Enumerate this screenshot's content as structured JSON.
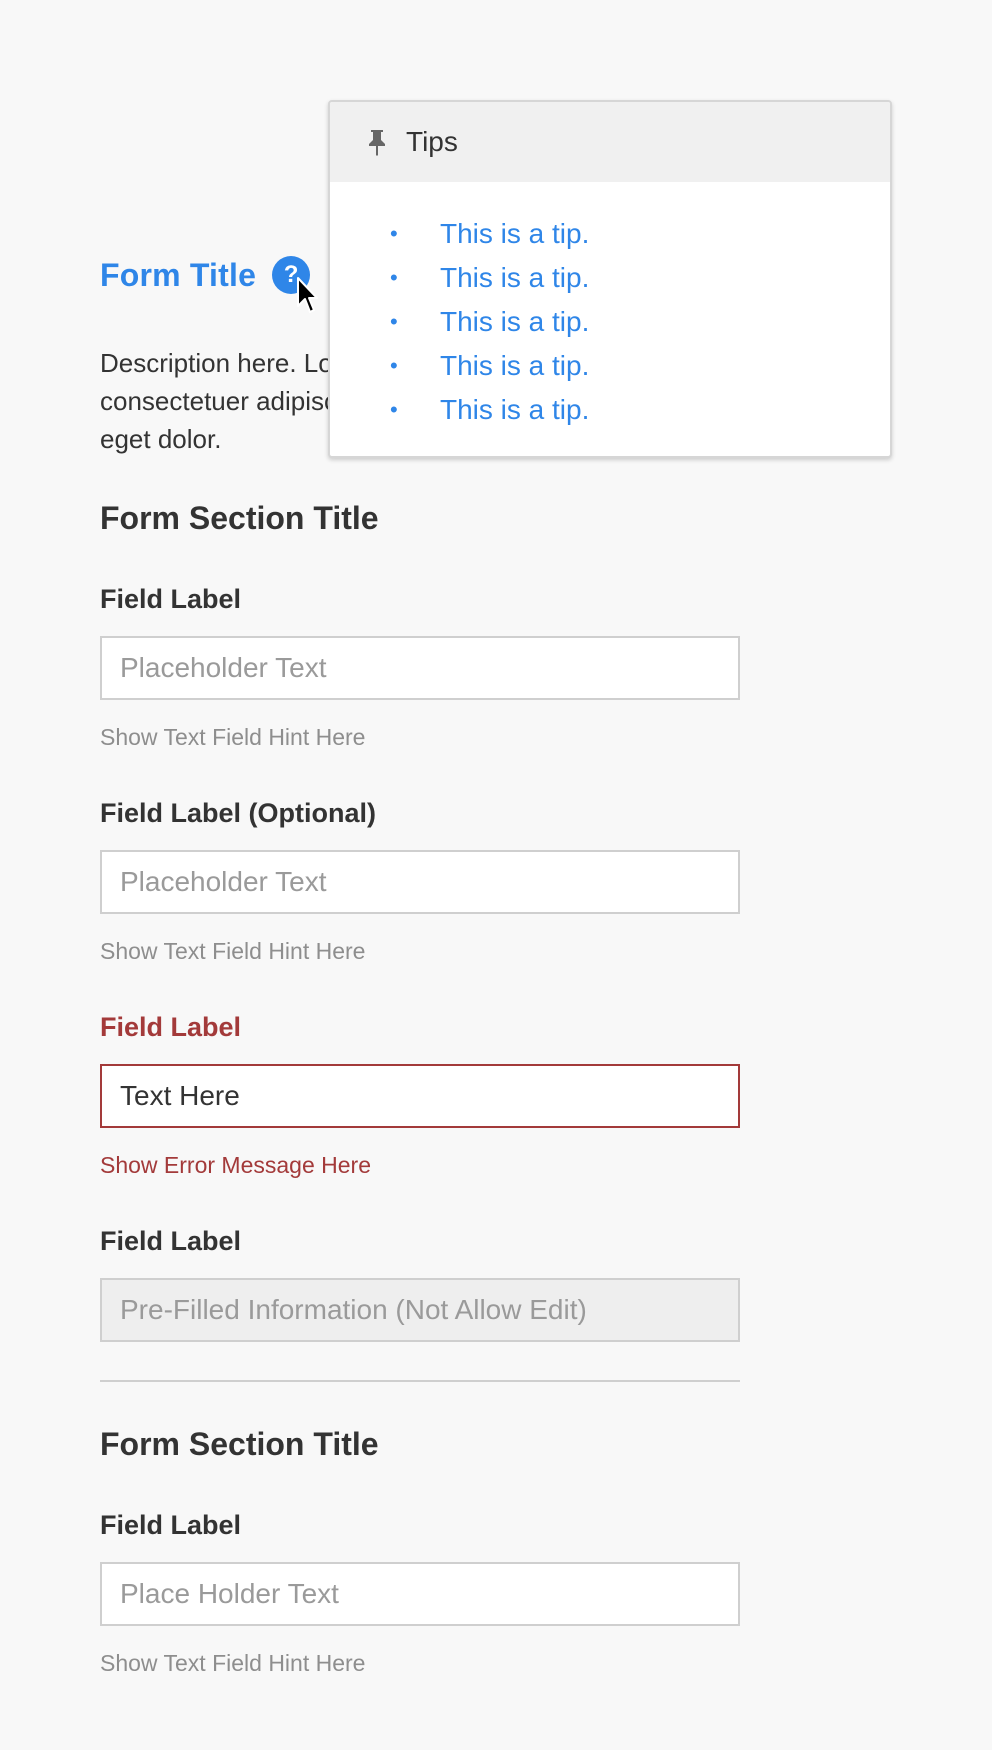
{
  "form": {
    "title": "Form Title",
    "help_symbol": "?",
    "description": "Description here. Lorem ipsum dolor sit amet, consectetuer adipiscing elit. Aenean commodo ligula eget dolor."
  },
  "tips": {
    "title": "Tips",
    "icon": "pin-icon",
    "bullet": "•",
    "items": [
      "This is a tip.",
      "This is a tip.",
      "This is a tip.",
      "This is a tip.",
      "This is a tip."
    ]
  },
  "section1": {
    "title": "Form Section Title",
    "field1": {
      "label": "Field Label",
      "placeholder": "Placeholder Text",
      "hint": "Show Text Field Hint Here"
    },
    "field2": {
      "label": "Field Label (Optional)",
      "placeholder": "Placeholder Text",
      "hint": "Show Text Field Hint Here"
    },
    "field3": {
      "label": "Field Label",
      "value": "Text Here",
      "error": "Show Error Message Here"
    },
    "field4": {
      "label": "Field Label",
      "placeholder": "Pre-Filled Information (Not Allow Edit)"
    }
  },
  "section2": {
    "title": "Form Section Title",
    "field1": {
      "label": "Field Label",
      "placeholder": "Place Holder Text",
      "hint": "Show Text Field Hint Here"
    }
  },
  "colors": {
    "accent": "#2f86e8",
    "error": "#a33a3a",
    "background": "#f8f8f8",
    "text": "#333333",
    "hint": "#8e8e8e"
  }
}
